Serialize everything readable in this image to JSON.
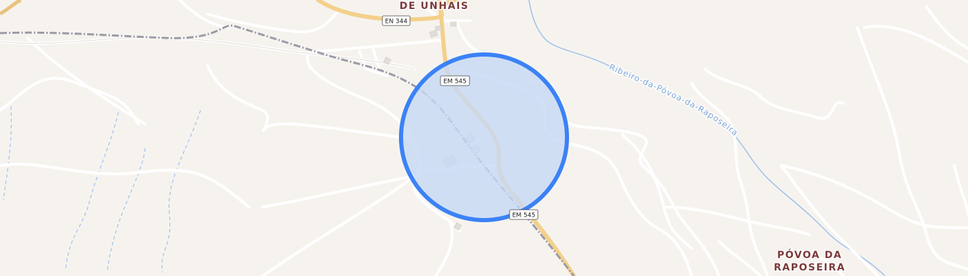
{
  "map": {
    "colors": {
      "land": "#f6f3ef",
      "road_minor": "#ffffff",
      "road_main": "#f3d08b",
      "railway": "#9b9aa6",
      "water": "#9cc0ea",
      "place_label": "#7a3a3a",
      "highlight_stroke": "#3b82f6",
      "highlight_fill": "#c7d8f5"
    },
    "places": [
      {
        "id": "de-unhais",
        "label": "DE UNHAIS"
      },
      {
        "id": "povoa-da-raposeira-1",
        "label": "PÓVOA DA"
      },
      {
        "id": "povoa-da-raposeira-2",
        "label": "RAPOSEIRA"
      }
    ],
    "waterways": [
      {
        "id": "ribeiro",
        "label": "Ribeiro-da-Póvoa-da-Raposeira"
      }
    ],
    "road_shields": [
      {
        "id": "en344",
        "label": "EN 344"
      },
      {
        "id": "em545-top",
        "label": "EM 545"
      },
      {
        "id": "em545-bottom",
        "label": "EM 545"
      }
    ],
    "highlight": {
      "shape": "circle",
      "meaning": "selected area"
    }
  }
}
